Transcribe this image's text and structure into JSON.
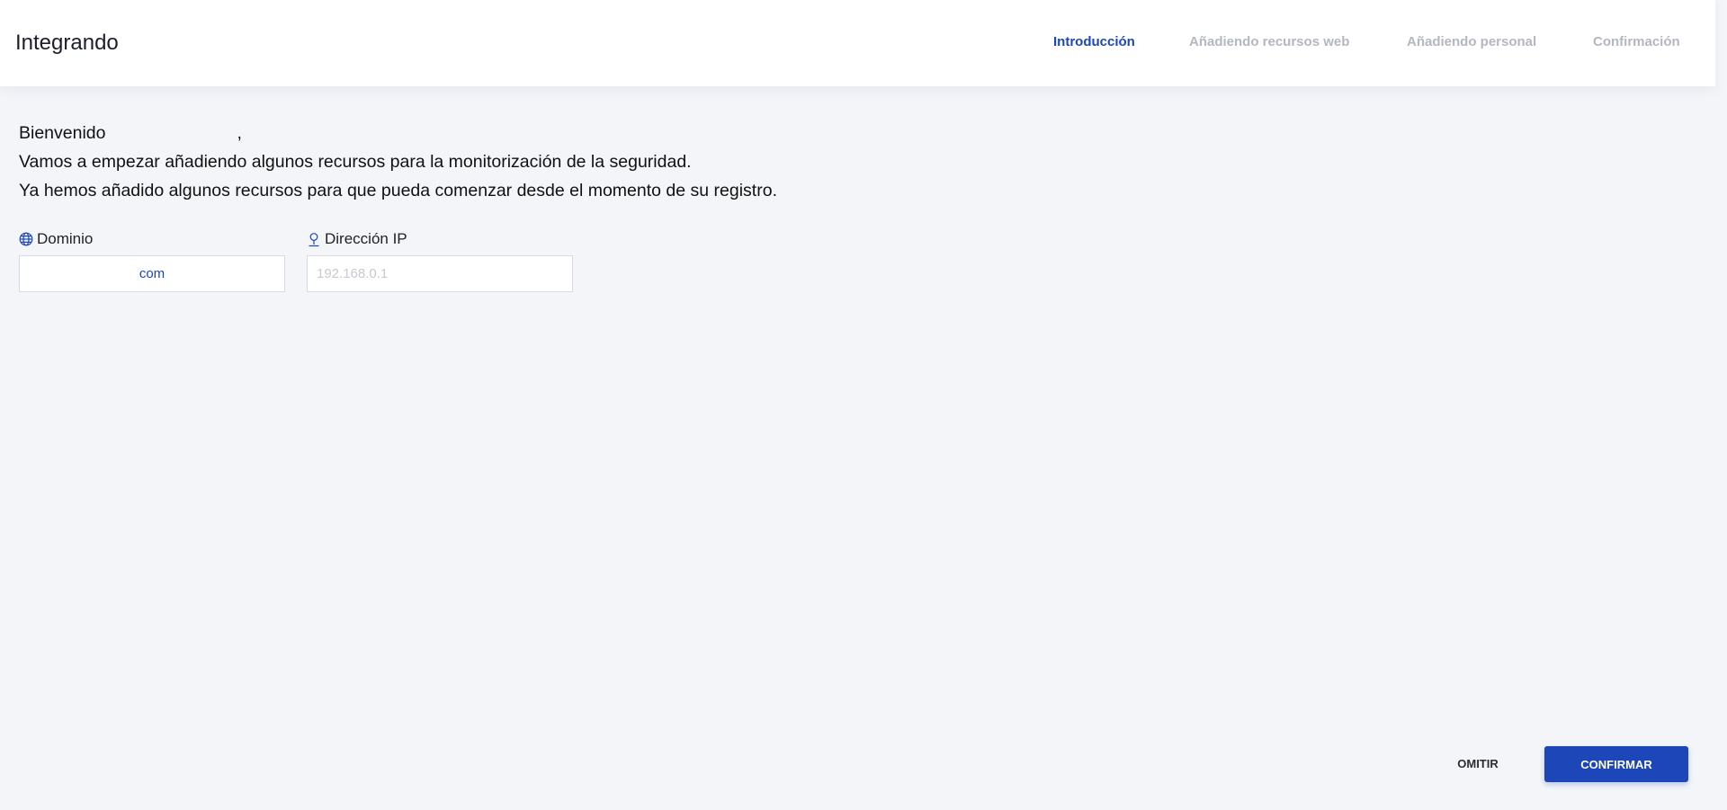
{
  "app": {
    "title": "Integrando"
  },
  "steps": [
    {
      "label": "Introducción",
      "active": true
    },
    {
      "label": "Añadiendo recursos web",
      "active": false
    },
    {
      "label": "Añadiendo personal",
      "active": false
    },
    {
      "label": "Confirmación",
      "active": false
    }
  ],
  "intro": {
    "welcome": "Bienvenido",
    "comma": ",",
    "line2": "Vamos a empezar añadiendo algunos recursos para la monitorización de la seguridad.",
    "line3": "Ya hemos añadido algunos recursos para que pueda comenzar desde el momento de su registro."
  },
  "fields": {
    "domain": {
      "label": "Dominio",
      "value": "com",
      "icon": "globe-icon"
    },
    "ip": {
      "label": "Dirección IP",
      "placeholder": "192.168.0.1",
      "icon": "location-pin-icon"
    }
  },
  "actions": {
    "skip_label": "OMITIR",
    "confirm_label": "CONFIRMAR"
  },
  "colors": {
    "accent": "#1d47b8",
    "background": "#f3f5f9",
    "inactive_step": "#b3b7c0"
  }
}
